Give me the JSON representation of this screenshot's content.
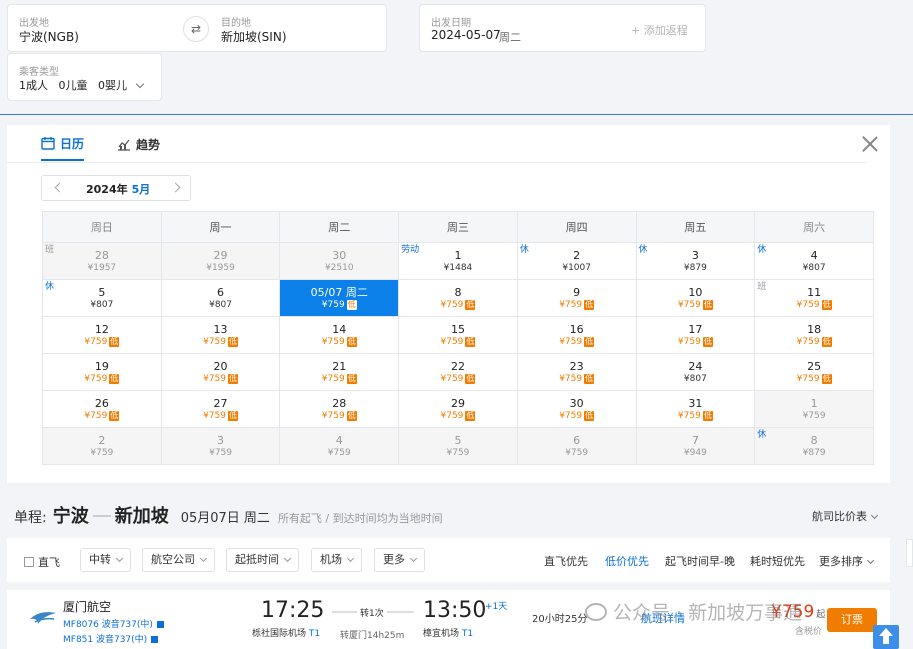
{
  "search": {
    "origin": {
      "label": "出发地",
      "value": "宁波(NGB)"
    },
    "swap_glyph": "⇄",
    "destination": {
      "label": "目的地",
      "value": "新加坡(SIN)"
    },
    "depart": {
      "label": "出发日期",
      "value": "2024-05-07",
      "weekday": "周二"
    },
    "add_return": "+ 添加返程",
    "passenger": {
      "label": "乘客类型",
      "value": "1成人   0儿童   0婴儿"
    }
  },
  "calendar": {
    "tabs": [
      {
        "label": "日历",
        "icon": "calendar-icon",
        "active": true
      },
      {
        "label": "趋势",
        "icon": "trend-chart-icon",
        "active": false
      }
    ],
    "year_label": "2024年",
    "month_label": "5月",
    "weekdays": [
      "周日",
      "周一",
      "周二",
      "周三",
      "周四",
      "周五",
      "周六"
    ],
    "low_tag": "低",
    "weeks": [
      [
        {
          "day": "28",
          "price": "¥1957",
          "out": true,
          "tag": "班",
          "tagType": "work"
        },
        {
          "day": "29",
          "price": "¥1959",
          "out": true
        },
        {
          "day": "30",
          "price": "¥2510",
          "out": true
        },
        {
          "day": "1",
          "price": "¥1484",
          "tag": "劳动",
          "tagType": "holiday"
        },
        {
          "day": "2",
          "price": "¥1007",
          "tag": "休",
          "tagType": "holiday"
        },
        {
          "day": "3",
          "price": "¥879",
          "tag": "休",
          "tagType": "holiday"
        },
        {
          "day": "4",
          "price": "¥807",
          "tag": "休",
          "tagType": "holiday"
        }
      ],
      [
        {
          "day": "5",
          "price": "¥807",
          "tag": "休",
          "tagType": "holiday"
        },
        {
          "day": "6",
          "price": "¥807"
        },
        {
          "day": "05/07 周二",
          "price": "¥759",
          "low": true,
          "selected": true
        },
        {
          "day": "8",
          "price": "¥759",
          "low": true
        },
        {
          "day": "9",
          "price": "¥759",
          "low": true
        },
        {
          "day": "10",
          "price": "¥759",
          "low": true
        },
        {
          "day": "11",
          "price": "¥759",
          "low": true,
          "tag": "班",
          "tagType": "work"
        }
      ],
      [
        {
          "day": "12",
          "price": "¥759",
          "low": true
        },
        {
          "day": "13",
          "price": "¥759",
          "low": true
        },
        {
          "day": "14",
          "price": "¥759",
          "low": true
        },
        {
          "day": "15",
          "price": "¥759",
          "low": true
        },
        {
          "day": "16",
          "price": "¥759",
          "low": true
        },
        {
          "day": "17",
          "price": "¥759",
          "low": true
        },
        {
          "day": "18",
          "price": "¥759",
          "low": true
        }
      ],
      [
        {
          "day": "19",
          "price": "¥759",
          "low": true
        },
        {
          "day": "20",
          "price": "¥759",
          "low": true
        },
        {
          "day": "21",
          "price": "¥759",
          "low": true
        },
        {
          "day": "22",
          "price": "¥759",
          "low": true
        },
        {
          "day": "23",
          "price": "¥759",
          "low": true
        },
        {
          "day": "24",
          "price": "¥807"
        },
        {
          "day": "25",
          "price": "¥759",
          "low": true
        }
      ],
      [
        {
          "day": "26",
          "price": "¥759",
          "low": true
        },
        {
          "day": "27",
          "price": "¥759",
          "low": true
        },
        {
          "day": "28",
          "price": "¥759",
          "low": true
        },
        {
          "day": "29",
          "price": "¥759",
          "low": true
        },
        {
          "day": "30",
          "price": "¥759",
          "low": true
        },
        {
          "day": "31",
          "price": "¥759",
          "low": true
        },
        {
          "day": "1",
          "price": "¥759",
          "out": true
        }
      ],
      [
        {
          "day": "2",
          "price": "¥759",
          "out": true
        },
        {
          "day": "3",
          "price": "¥759",
          "out": true
        },
        {
          "day": "4",
          "price": "¥759",
          "out": true
        },
        {
          "day": "5",
          "price": "¥759",
          "out": true
        },
        {
          "day": "6",
          "price": "¥759",
          "out": true
        },
        {
          "day": "7",
          "price": "¥949",
          "out": true
        },
        {
          "day": "8",
          "price": "¥879",
          "out": true,
          "tag": "休",
          "tagType": "holiday"
        }
      ]
    ]
  },
  "summary": {
    "prefix": "单程:",
    "from": "宁波",
    "to": "新加坡",
    "date": "05月07日 周二",
    "note": "所有起飞 / 到达时间均为当地时间",
    "compare": "航司比价表"
  },
  "filters": {
    "direct": "直飞",
    "dropdowns": [
      "中转",
      "航空公司",
      "起抵时间",
      "机场",
      "更多"
    ],
    "sorts": [
      {
        "label": "直飞优先",
        "active": false
      },
      {
        "label": "低价优先",
        "active": true
      },
      {
        "label": "起飞时间早-晚",
        "active": false
      },
      {
        "label": "耗时短优先",
        "active": false
      },
      {
        "label": "更多排序",
        "active": false
      }
    ]
  },
  "flight": {
    "airline": "厦门航空",
    "segments": [
      "MF8076 波音737(中)",
      "MF851 波音737(中)"
    ],
    "depart_time": "17:25",
    "depart_airport": "栎社国际机场",
    "depart_terminal": "T1",
    "stops": "转1次",
    "via": "转厦门14h25m",
    "arrive_time": "13:50",
    "day_offset": "+1天",
    "arrive_airport": "樟宜机场",
    "arrive_terminal": "T1",
    "duration": "20小时25分",
    "detail": "航班详情",
    "price": "¥759",
    "price_suffix": "起",
    "tax_note": "含税价",
    "book": "订票"
  },
  "watermark": "公众号 · 新加坡万事通"
}
